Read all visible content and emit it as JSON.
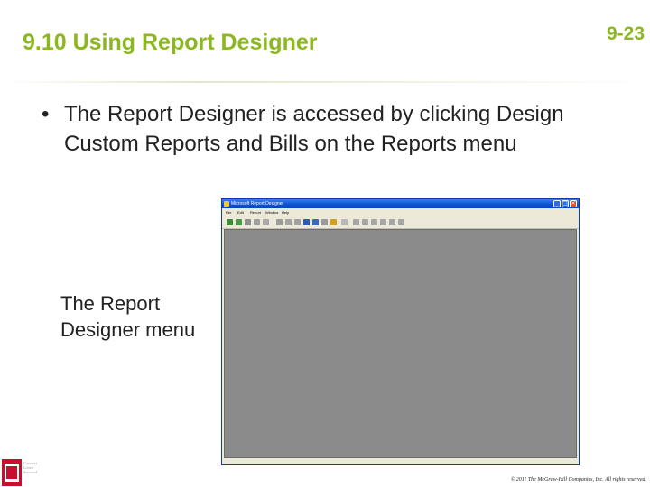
{
  "slide": {
    "title": "9.10 Using Report Designer",
    "number": "9-23",
    "bullet_mark": "•",
    "bullet": "The Report Designer is accessed by clicking Design Custom Reports and Bills on the Reports menu",
    "caption_line1": "The Report",
    "caption_line2": "Designer menu",
    "copyright": "© 2011 The McGraw-Hill Companies, Inc. All rights reserved.",
    "logo_text_line1": "Connect",
    "logo_text_line2": "Learn",
    "logo_text_line3": "Succeed"
  },
  "window": {
    "title": "Microsoft Report Designer",
    "menu": [
      "File",
      "Edit",
      "Report",
      "Window",
      "Help"
    ],
    "controls": {
      "minimize": "_",
      "maximize": "□",
      "close": "×"
    },
    "toolbar_icons": [
      "new-report-icon",
      "open-icon",
      "save-icon",
      "print-icon",
      "preview-icon",
      "cut-icon",
      "copy-icon",
      "paste-icon",
      "format-icon",
      "label-icon",
      "field-icon",
      "group-icon",
      "help-icon",
      "align-left-icon",
      "align-center-icon",
      "align-right-icon",
      "font-icon",
      "border-icon",
      "color-icon"
    ],
    "colors": {
      "titlebar": "#0a4fd4",
      "client": "#8b8b8b",
      "chrome": "#ece9d8"
    }
  },
  "colors": {
    "accent": "#8cb71f",
    "text": "#222222"
  }
}
